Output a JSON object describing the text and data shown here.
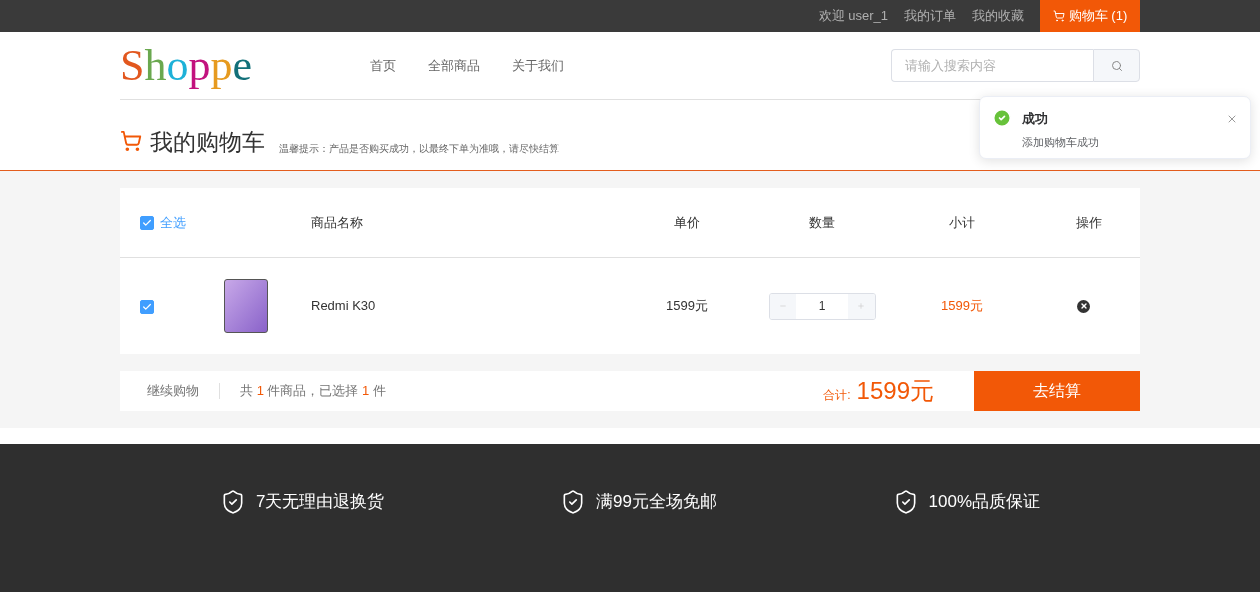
{
  "top_bar": {
    "welcome": "欢迎 user_1",
    "links": [
      "我的订单",
      "我的收藏"
    ],
    "cart_button": "购物车 (1)"
  },
  "header": {
    "logo": "Shoppe",
    "nav": [
      {
        "label": "首页"
      },
      {
        "label": "全部商品"
      },
      {
        "label": "关于我们"
      }
    ],
    "search": {
      "placeholder": "请输入搜索内容"
    }
  },
  "page_title": {
    "title": "我的购物车",
    "tip": "温馨提示：产品是否购买成功，以最终下单为准哦，请尽快结算"
  },
  "table": {
    "select_all": {
      "label": "全选",
      "checked": true
    },
    "columns": [
      "商品名称",
      "单价",
      "数量",
      "小计",
      "操作"
    ],
    "rows": [
      {
        "checked": true,
        "name": "Redmi K30",
        "price": "1599元",
        "quantity": "1",
        "subtotal": "1599元"
      }
    ]
  },
  "summary_bar": {
    "continue": "继续购物",
    "count": {
      "prefix": "共",
      "total": "1",
      "middle": "件商品，已选择",
      "selected": "1",
      "suffix": "件"
    },
    "total_label": "合计:",
    "total": "1599元",
    "checkout": "去结算"
  },
  "footer": {
    "features": [
      "7天无理由退换货",
      "满99元全场免邮",
      "100%品质保证"
    ]
  },
  "toast": {
    "title": "成功",
    "message": "添加购物车成功"
  }
}
